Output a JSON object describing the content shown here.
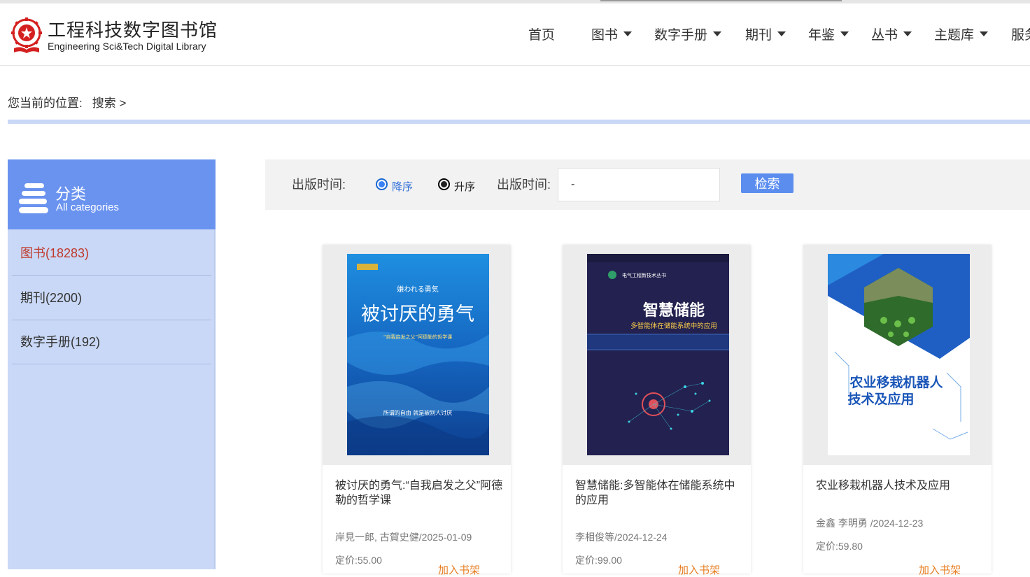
{
  "header": {
    "logo_cn": "工程科技数字图书馆",
    "logo_en": "Engineering Sci&Tech Digital Library",
    "nav": [
      {
        "label": "首页",
        "dropdown": false
      },
      {
        "label": "图书",
        "dropdown": true
      },
      {
        "label": "数字手册",
        "dropdown": true
      },
      {
        "label": "期刊",
        "dropdown": true
      },
      {
        "label": "年鉴",
        "dropdown": true
      },
      {
        "label": "丛书",
        "dropdown": true
      },
      {
        "label": "主题库",
        "dropdown": true
      },
      {
        "label": "服务",
        "dropdown": false
      }
    ]
  },
  "breadcrumb": {
    "prefix": "您当前的位置:",
    "current": "搜索 >"
  },
  "sidebar": {
    "title": "分类",
    "subtitle": "All categories",
    "items": [
      {
        "label": "图书(18283)",
        "active": true
      },
      {
        "label": "期刊(2200)",
        "active": false
      },
      {
        "label": "数字手册(192)",
        "active": false
      }
    ]
  },
  "filter": {
    "label1": "出版时间:",
    "desc_label": "降序",
    "asc_label": "升序",
    "label2": "出版时间:",
    "date_value": "-",
    "search_label": "检索"
  },
  "books": [
    {
      "title": "被讨厌的勇气:“自我启发之父”阿德勒的哲学课",
      "author_date": "岸見一郎, 古賀史健/2025-01-09",
      "price": "定价:55.00",
      "add": "加入书架",
      "cover": {
        "jp": "嫌われる勇気",
        "main": "被讨厌的勇气",
        "sub": "“自我启发之父”阿德勒的哲学课",
        "quote": "所谓的自由 就是被别人讨厌"
      }
    },
    {
      "title": "智慧储能:多智能体在储能系统中的应用",
      "author_date": "李相俊等/2024-12-24",
      "price": "定价:99.00",
      "add": "加入书架",
      "cover": {
        "series": "电气工程新技术丛书",
        "main": "智慧储能",
        "sub": "多智能体在储能系统中的应用"
      }
    },
    {
      "title": "农业移栽机器人技术及应用",
      "author_date": "金鑫 李明勇 /2024-12-23",
      "price": "定价:59.80",
      "add": "加入书架",
      "cover": {
        "main1": "农业移栽机器人",
        "main2": "技术及应用"
      }
    }
  ],
  "colors": {
    "accent": "#5b8def",
    "sidebar_bg": "#c9d8f6",
    "sidebar_head": "#6a93ef",
    "active": "#c0392b",
    "add_orange": "#e67e22"
  }
}
